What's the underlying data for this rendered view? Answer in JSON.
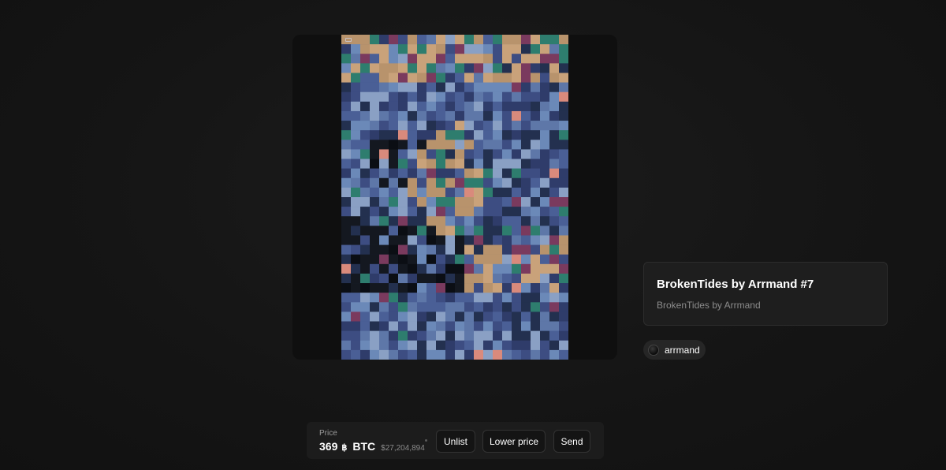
{
  "artwork": {
    "palette": [
      "#3d4d82",
      "#4a5f96",
      "#2f3c6a",
      "#5e77a8",
      "#c9a27a",
      "#b8936c",
      "#141820",
      "#0b0e14",
      "#2e7d6e",
      "#7a3a5e",
      "#d98a7c",
      "#6b89b8",
      "#23304f",
      "#8aa0c4"
    ]
  },
  "info": {
    "title": "BrokenTides by Arrmand #7",
    "collection": "BrokenTides by Arrmand"
  },
  "owner": {
    "name": "arrmand"
  },
  "price": {
    "label": "Price",
    "value": "369",
    "symbol": "฿",
    "unit": "BTC",
    "usd": "$27,204,894"
  },
  "actions": {
    "unlist": "Unlist",
    "lower_price": "Lower price",
    "send": "Send"
  }
}
